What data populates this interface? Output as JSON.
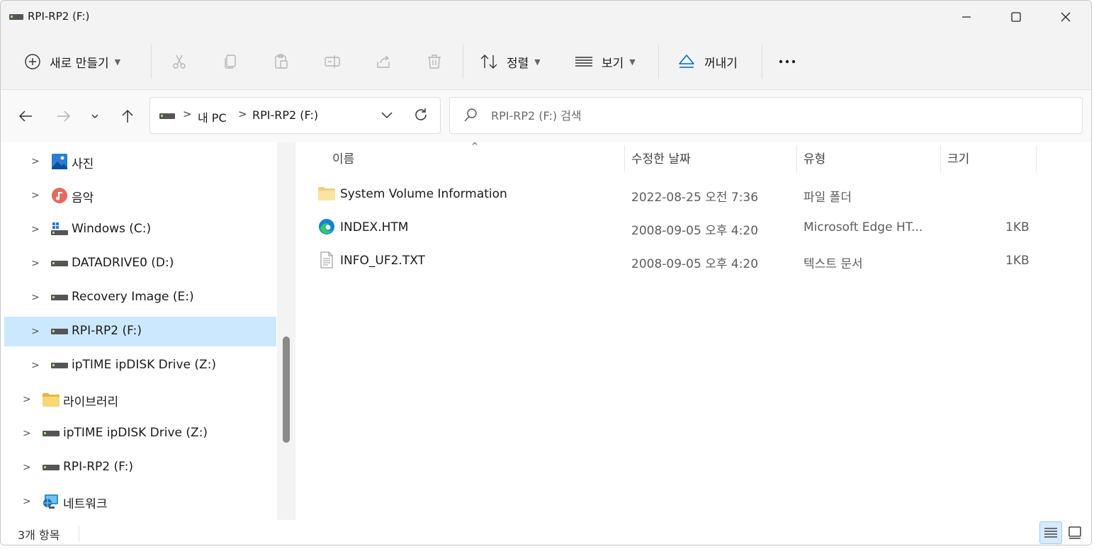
{
  "window": {
    "title": "RPI-RP2 (F:)"
  },
  "toolbar": {
    "new_label": "새로 만들기",
    "sort_label": "정렬",
    "view_label": "보기",
    "eject_label": "꺼내기",
    "more_label": "..."
  },
  "nav": {
    "breadcrumb": [
      "내 PC",
      "RPI-RP2 (F:)"
    ],
    "search_placeholder": "RPI-RP2 (F:) 검색"
  },
  "sidebar": {
    "items": [
      {
        "label": "사진",
        "icon": "pictures-icon",
        "level": 1
      },
      {
        "label": "음악",
        "icon": "music-icon",
        "level": 1
      },
      {
        "label": "Windows (C:)",
        "icon": "windows-drive-icon",
        "level": 1
      },
      {
        "label": "DATADRIVE0 (D:)",
        "icon": "drive-icon",
        "level": 1
      },
      {
        "label": "Recovery Image (E:)",
        "icon": "drive-icon",
        "level": 1
      },
      {
        "label": "RPI-RP2 (F:)",
        "icon": "drive-icon",
        "level": 1,
        "selected": true
      },
      {
        "label": "ipTIME ipDISK Drive (Z:)",
        "icon": "drive-icon",
        "level": 1
      },
      {
        "label": "라이브러리",
        "icon": "folder-icon",
        "level": 0
      },
      {
        "label": "ipTIME ipDISK Drive (Z:)",
        "icon": "drive-icon",
        "level": 0
      },
      {
        "label": "RPI-RP2 (F:)",
        "icon": "drive-icon",
        "level": 0
      },
      {
        "label": "네트워크",
        "icon": "network-icon",
        "level": 0
      }
    ]
  },
  "columns": {
    "name": "이름",
    "date": "수정한 날짜",
    "type": "유형",
    "size": "크기"
  },
  "files": [
    {
      "name": "System Volume Information",
      "date": "2022-08-25 오전 7:36",
      "type": "파일 폴더",
      "size": "",
      "icon": "folder-icon"
    },
    {
      "name": "INDEX.HTM",
      "date": "2008-09-05 오후 4:20",
      "type": "Microsoft Edge HT...",
      "size": "1KB",
      "icon": "edge-icon"
    },
    {
      "name": "INFO_UF2.TXT",
      "date": "2008-09-05 오후 4:20",
      "type": "텍스트 문서",
      "size": "1KB",
      "icon": "text-file-icon"
    }
  ],
  "status": {
    "item_count": "3개 항목"
  },
  "colors": {
    "selected": "#cce8ff",
    "accent": "#0067c0"
  }
}
